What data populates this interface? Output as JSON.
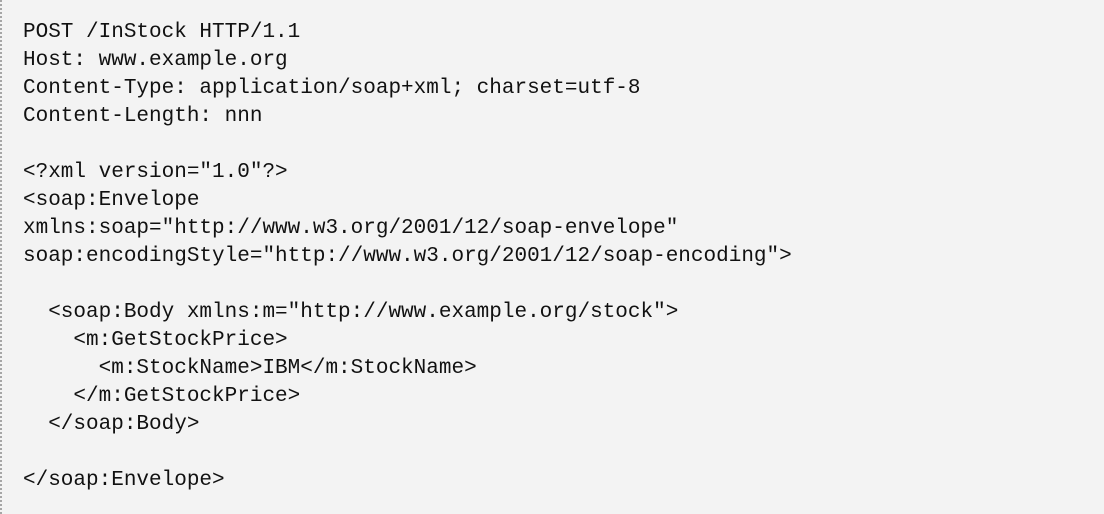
{
  "code_block": {
    "lines": [
      "POST /InStock HTTP/1.1",
      "Host: www.example.org",
      "Content-Type: application/soap+xml; charset=utf-8",
      "Content-Length: nnn",
      "",
      "<?xml version=\"1.0\"?>",
      "<soap:Envelope",
      "xmlns:soap=\"http://www.w3.org/2001/12/soap-envelope\"",
      "soap:encodingStyle=\"http://www.w3.org/2001/12/soap-encoding\">",
      "",
      "  <soap:Body xmlns:m=\"http://www.example.org/stock\">",
      "    <m:GetStockPrice>",
      "      <m:StockName>IBM</m:StockName>",
      "    </m:GetStockPrice>",
      "  </soap:Body>",
      "",
      "</soap:Envelope>"
    ]
  }
}
